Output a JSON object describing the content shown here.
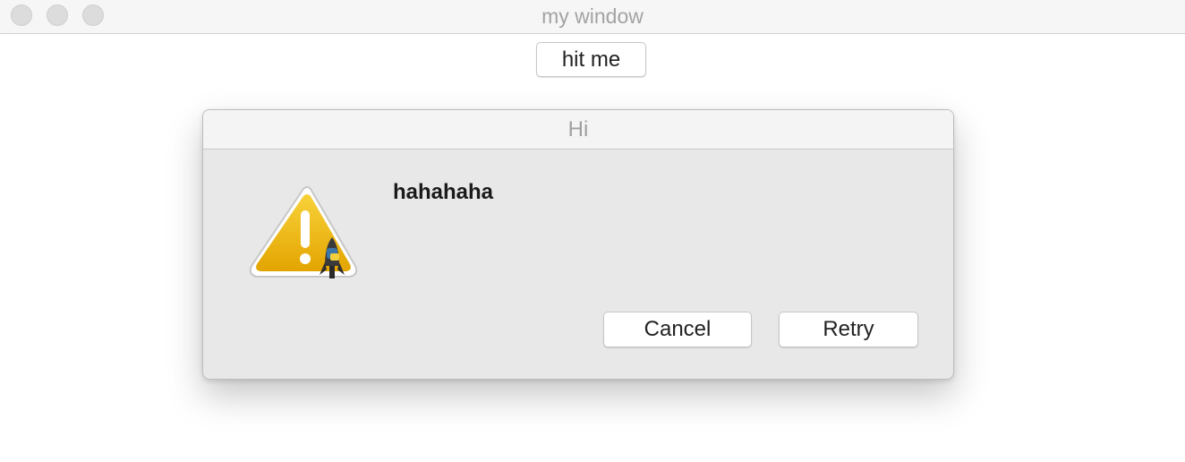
{
  "window": {
    "title": "my window",
    "controls": [
      "close",
      "minimize",
      "zoom"
    ]
  },
  "main": {
    "hit_button_label": "hit me"
  },
  "dialog": {
    "title": "Hi",
    "message": "hahahaha",
    "icon": "warning-icon",
    "buttons": {
      "cancel_label": "Cancel",
      "retry_label": "Retry"
    }
  },
  "colors": {
    "warning_yellow": "#f0b400",
    "dialog_background": "#e8e8e8",
    "titlebar_text": "#a3a3a3"
  }
}
